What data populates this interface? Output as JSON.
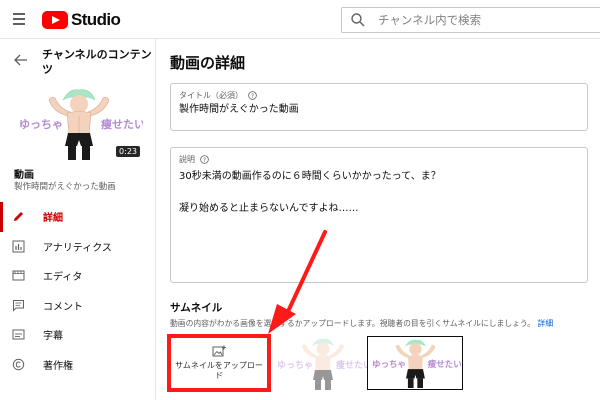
{
  "app": {
    "logo_text": "Studio",
    "search_placeholder": "チャンネル内で検索"
  },
  "sidebar": {
    "channel_title": "チャンネルのコンテンツ",
    "thumbnail": {
      "overlay_left": "ゆっちゃ",
      "overlay_right": "痩せたい",
      "duration": "0:23"
    },
    "video_label": "動画",
    "video_subtitle": "製作時間がえぐかった動画",
    "nav": [
      {
        "label": "詳細",
        "icon": "pencil-icon",
        "active": true
      },
      {
        "label": "アナリティクス",
        "icon": "analytics-icon",
        "active": false
      },
      {
        "label": "エディタ",
        "icon": "editor-icon",
        "active": false
      },
      {
        "label": "コメント",
        "icon": "comment-icon",
        "active": false
      },
      {
        "label": "字幕",
        "icon": "subtitles-icon",
        "active": false
      },
      {
        "label": "著作権",
        "icon": "copyright-icon",
        "active": false
      }
    ]
  },
  "main": {
    "page_title": "動画の詳細",
    "title_field": {
      "label": "タイトル（必須）",
      "value": "製作時間がえぐかった動画"
    },
    "description_field": {
      "label": "説明",
      "line1": "30秒未満の動画作るのに６時間くらいかかったって、ま？",
      "line2": "凝り始めると止まらないんですよね……"
    },
    "thumbnail_section": {
      "heading": "サムネイル",
      "help_text": "動画の内容がわかる画像を選択するかアップロードします。視聴者の目を引くサムネイルにしましょう。",
      "help_link": "詳細",
      "upload_label": "サムネイルをアップロード",
      "thumb_overlay_left": "ゆっちゃ",
      "thumb_overlay_right": "痩せたい"
    }
  },
  "colors": {
    "accent_red": "#cc0000",
    "annotation_red": "#ff1a1a",
    "link_blue": "#065fd4"
  }
}
